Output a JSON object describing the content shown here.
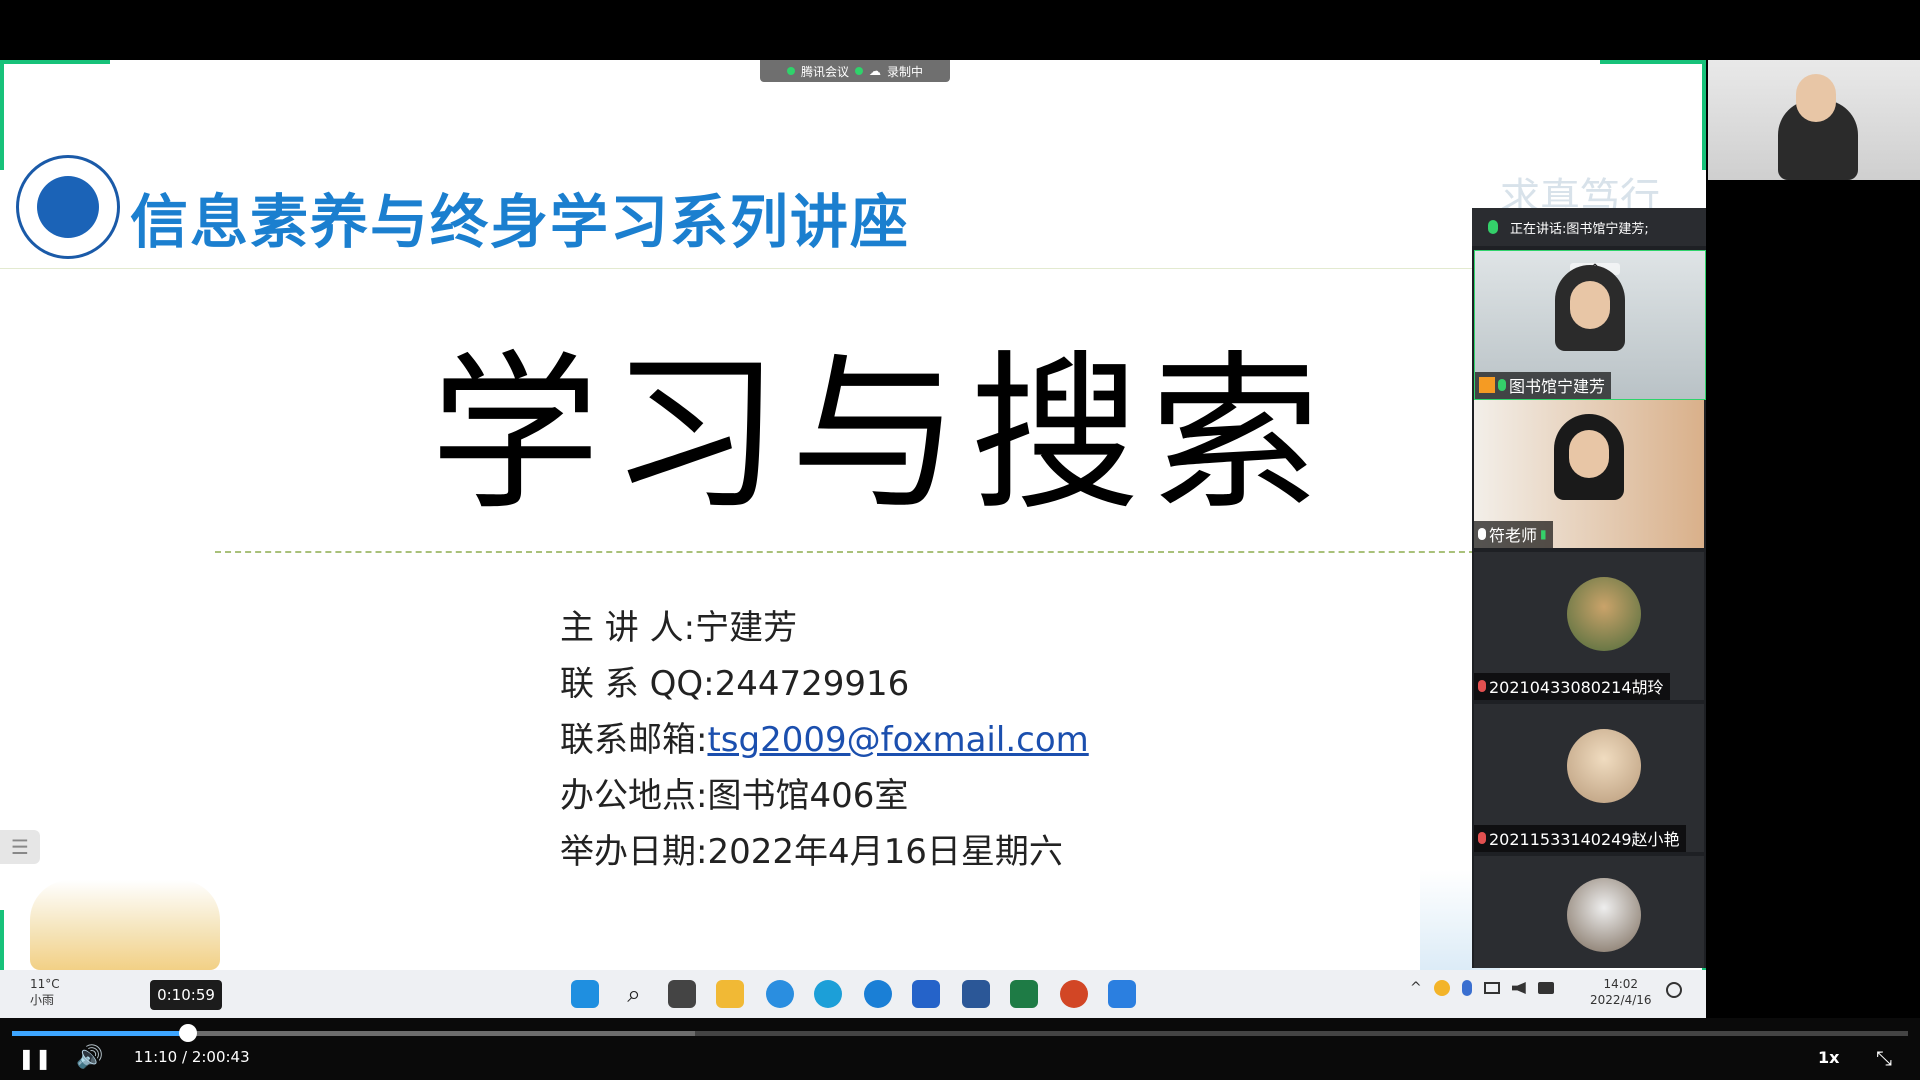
{
  "meeting": {
    "app_name": "腾讯会议",
    "recording_label": "录制中",
    "speaking_prefix": "正在讲话:",
    "speaking_name": "图书馆宁建芳;"
  },
  "slide": {
    "series_title": "信息素养与终身学习系列讲座",
    "watermark": "求真笃行",
    "main_title": "学习与搜索",
    "rows": [
      {
        "label": "主 讲 人:",
        "value": "宁建芳"
      },
      {
        "label": "联 系 QQ:",
        "value": "244729916"
      },
      {
        "label": "联系邮箱:",
        "value": "tsg2009@foxmail.com"
      },
      {
        "label": "办公地点:",
        "value": "图书馆406室"
      },
      {
        "label": "举办日期:",
        "value": "2022年4月16日星期六"
      }
    ]
  },
  "participants": [
    {
      "name": "图书馆宁建芳"
    },
    {
      "name": "符老师"
    },
    {
      "name": "20210433080214胡玲"
    },
    {
      "name": "20211533140249赵小艳"
    },
    {
      "name": ""
    }
  ],
  "taskbar": {
    "temperature": "11°C",
    "weather": "小雨",
    "time": "14:02",
    "date": "2022/4/16",
    "tray_chevron": "^"
  },
  "player": {
    "timestamp_hover": "0:10:59",
    "time_readout": "11:10 / 2:00:43",
    "speed": "1x",
    "progress_fraction": 0.093,
    "buffered_fraction": 0.36
  },
  "colors": {
    "accent_blue": "#1b7fcf",
    "progress_blue": "#3ea6ff",
    "edge_green": "#17c27a"
  }
}
